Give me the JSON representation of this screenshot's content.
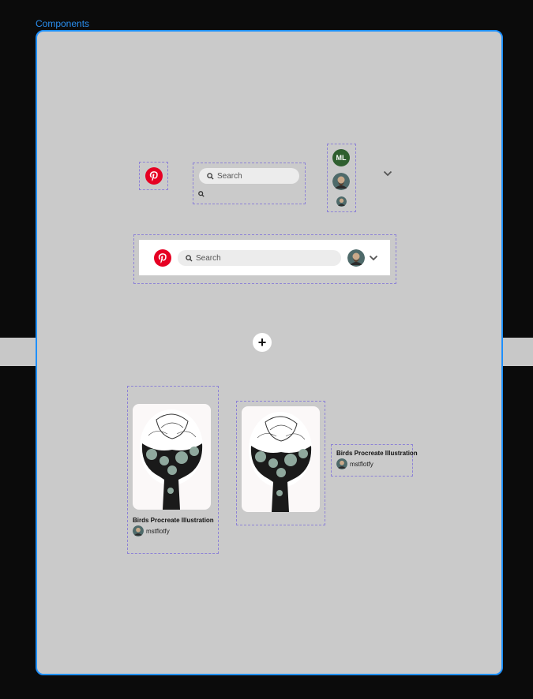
{
  "frame": {
    "title": "Components"
  },
  "search": {
    "placeholder": "Search"
  },
  "avatar_initials": "ML",
  "pin": {
    "title": "Birds Procreate Illustration",
    "user": "mstflotfy"
  },
  "colors": {
    "pinterest_red": "#e60023",
    "frame_border": "#1e90ff",
    "initials_bg": "#2f5f2f"
  },
  "icons": [
    "pinterest-logo-icon",
    "search-icon",
    "chevron-down-icon",
    "plus-icon"
  ]
}
